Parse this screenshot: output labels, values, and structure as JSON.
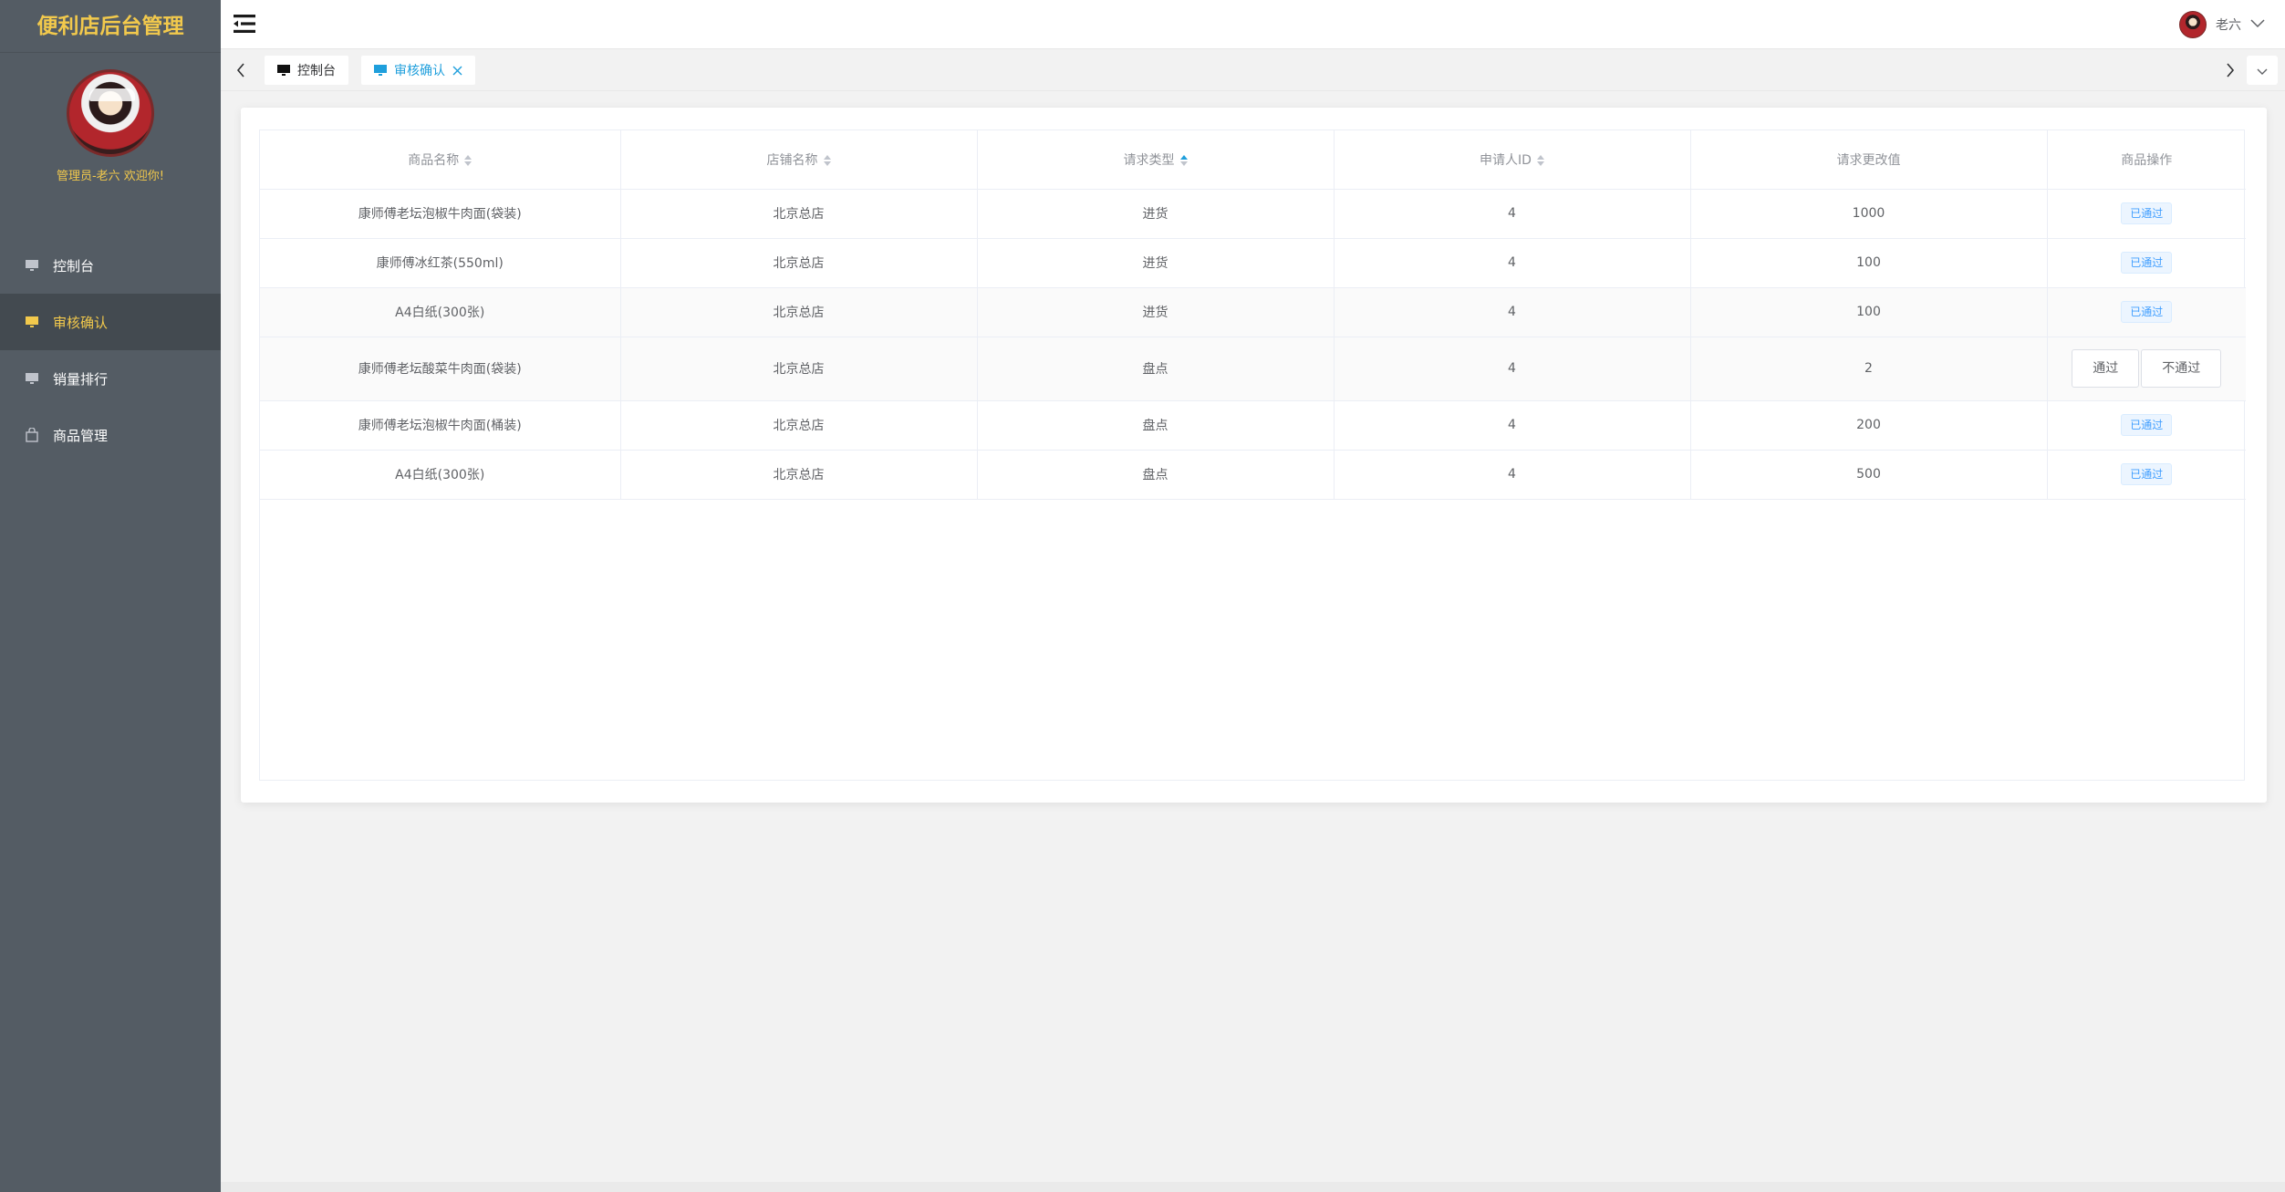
{
  "sidebar": {
    "brand": "便利店后台管理",
    "welcome": "管理员-老六 欢迎你!",
    "items": [
      {
        "label": "控制台",
        "icon": "monitor-icon",
        "active": false
      },
      {
        "label": "审核确认",
        "icon": "monitor-icon",
        "active": true
      },
      {
        "label": "销量排行",
        "icon": "monitor-icon",
        "active": false
      },
      {
        "label": "商品管理",
        "icon": "bag-icon",
        "active": false
      }
    ]
  },
  "header": {
    "username": "老六"
  },
  "tabs": [
    {
      "label": "控制台",
      "active": false,
      "closable": false
    },
    {
      "label": "审核确认",
      "active": true,
      "closable": true
    }
  ],
  "table": {
    "columns": [
      "商品名称",
      "店铺名称",
      "请求类型",
      "申请人ID",
      "请求更改值",
      "商品操作"
    ],
    "rows": [
      {
        "name": "康师傅老坛泡椒牛肉面(袋装)",
        "shop": "北京总店",
        "type": "进货",
        "applicant": "4",
        "value": "1000",
        "status": "已通过"
      },
      {
        "name": "康师傅冰红茶(550ml)",
        "shop": "北京总店",
        "type": "进货",
        "applicant": "4",
        "value": "100",
        "status": "已通过"
      },
      {
        "name": "A4白纸(300张)",
        "shop": "北京总店",
        "type": "进货",
        "applicant": "4",
        "value": "100",
        "status": "已通过"
      },
      {
        "name": "康师傅老坛酸菜牛肉面(袋装)",
        "shop": "北京总店",
        "type": "盘点",
        "applicant": "4",
        "value": "2",
        "approve": "通过",
        "reject": "不通过"
      },
      {
        "name": "康师傅老坛泡椒牛肉面(桶装)",
        "shop": "北京总店",
        "type": "盘点",
        "applicant": "4",
        "value": "200",
        "status": "已通过"
      },
      {
        "name": "A4白纸(300张)",
        "shop": "北京总店",
        "type": "盘点",
        "applicant": "4",
        "value": "500",
        "status": "已通过"
      }
    ]
  },
  "colors": {
    "sidebar_bg": "#545c64",
    "accent_yellow": "#f2c94c",
    "accent_blue": "#1f9fdc"
  }
}
